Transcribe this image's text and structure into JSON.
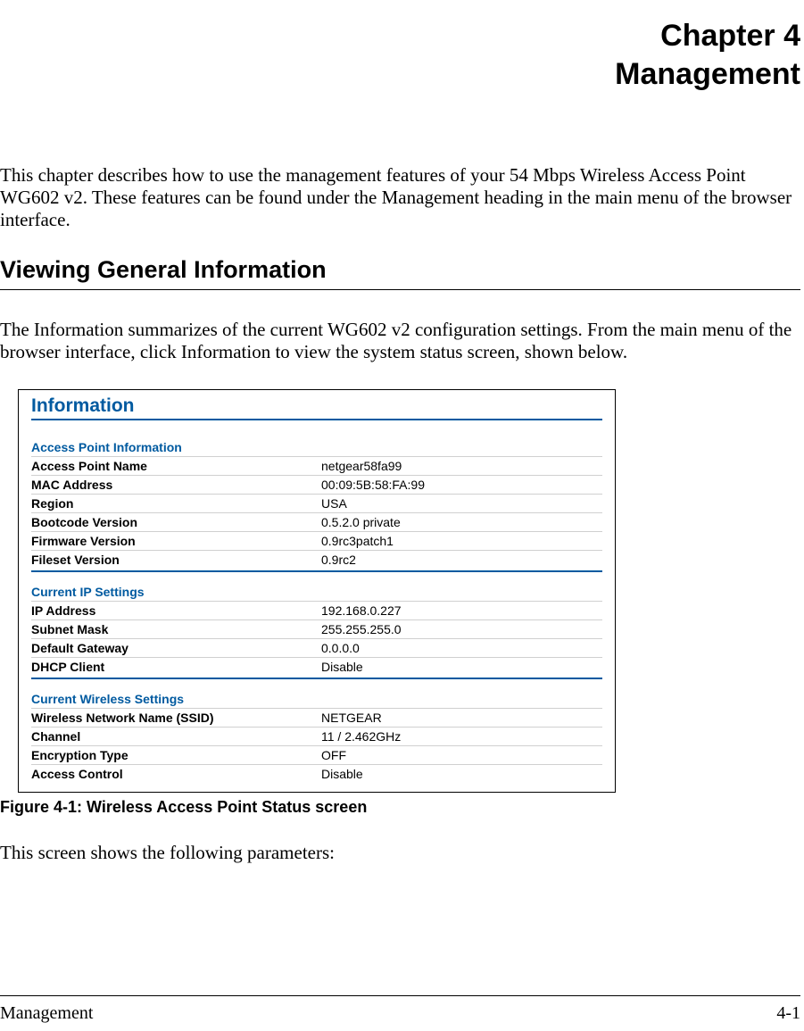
{
  "chapter": {
    "number_label": "Chapter 4",
    "title": "Management"
  },
  "intro_para": "This chapter describes how to use the management features of your 54 Mbps Wireless Access Point WG602 v2. These features can be found under the Management heading in the main menu of the browser interface.",
  "section_heading": "Viewing General Information",
  "section_para": "The Information summarizes of the current WG602 v2 configuration settings. From the main menu of the browser interface, click Information to view the system status screen, shown below.",
  "info_panel": {
    "title": "Information",
    "groups": [
      {
        "header": "Access Point Information",
        "rows": [
          {
            "k": "Access Point Name",
            "v": "netgear58fa99"
          },
          {
            "k": "MAC Address",
            "v": "00:09:5B:58:FA:99"
          },
          {
            "k": "Region",
            "v": "USA"
          },
          {
            "k": "Bootcode Version",
            "v": "0.5.2.0 private"
          },
          {
            "k": "Firmware Version",
            "v": "0.9rc3patch1"
          },
          {
            "k": "Fileset Version",
            "v": "0.9rc2"
          }
        ]
      },
      {
        "header": "Current IP Settings",
        "rows": [
          {
            "k": "IP Address",
            "v": "192.168.0.227"
          },
          {
            "k": "Subnet Mask",
            "v": "255.255.255.0"
          },
          {
            "k": "Default Gateway",
            "v": "0.0.0.0"
          },
          {
            "k": "DHCP Client",
            "v": "Disable"
          }
        ]
      },
      {
        "header": "Current Wireless Settings",
        "rows": [
          {
            "k": "Wireless Network Name (SSID)",
            "v": "NETGEAR"
          },
          {
            "k": "Channel",
            "v": "11 / 2.462GHz"
          },
          {
            "k": "Encryption Type",
            "v": "OFF"
          },
          {
            "k": "Access Control",
            "v": "Disable"
          }
        ]
      }
    ]
  },
  "figure_caption": "Figure 4-1:  Wireless Access Point Status screen",
  "closing_para": "This screen shows the following parameters:",
  "footer": {
    "left": "Management",
    "right": "4-1"
  }
}
